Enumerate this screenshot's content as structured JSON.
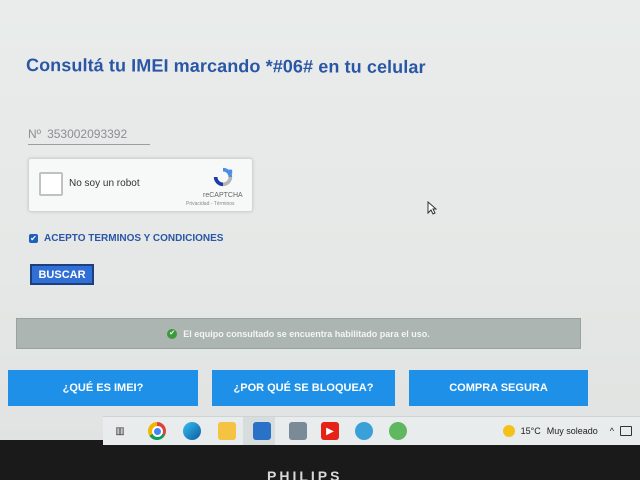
{
  "page": {
    "title": "Consultá tu IMEI marcando *#06# en tu celular"
  },
  "imei": {
    "prefix": "Nº",
    "value": "353002093392"
  },
  "captcha": {
    "label": "No soy un robot",
    "brand": "reCAPTCHA",
    "terms": "Privacidad - Términos"
  },
  "accept": {
    "label": "ACEPTO TERMINOS Y CONDICIONES",
    "checked": true
  },
  "search_button": "BUSCAR",
  "status": {
    "message": "El equipo consultado se encuentra habilitado para el uso."
  },
  "nav": {
    "items": [
      {
        "label": "¿QUÉ ES IMEI?"
      },
      {
        "label": "¿POR QUÉ SE BLOQUEA?"
      },
      {
        "label": "COMPRA SEGURA"
      }
    ]
  },
  "taskbar": {
    "icons": [
      "task-view-icon",
      "chrome-icon",
      "edge-icon",
      "file-explorer-icon",
      "outlook-icon",
      "calculator-icon",
      "youtube-icon",
      "app-icon",
      "app-icon-2"
    ],
    "weather_temp": "15°C",
    "weather_desc": "Muy soleado",
    "tray_chevron": "^"
  },
  "monitor": {
    "brand": "PHILIPS"
  },
  "colors": {
    "accent_blue": "#2a56a6",
    "button_blue": "#2f6fd6",
    "nav_blue": "#1e90e8",
    "status_gray": "#adb5b3"
  }
}
